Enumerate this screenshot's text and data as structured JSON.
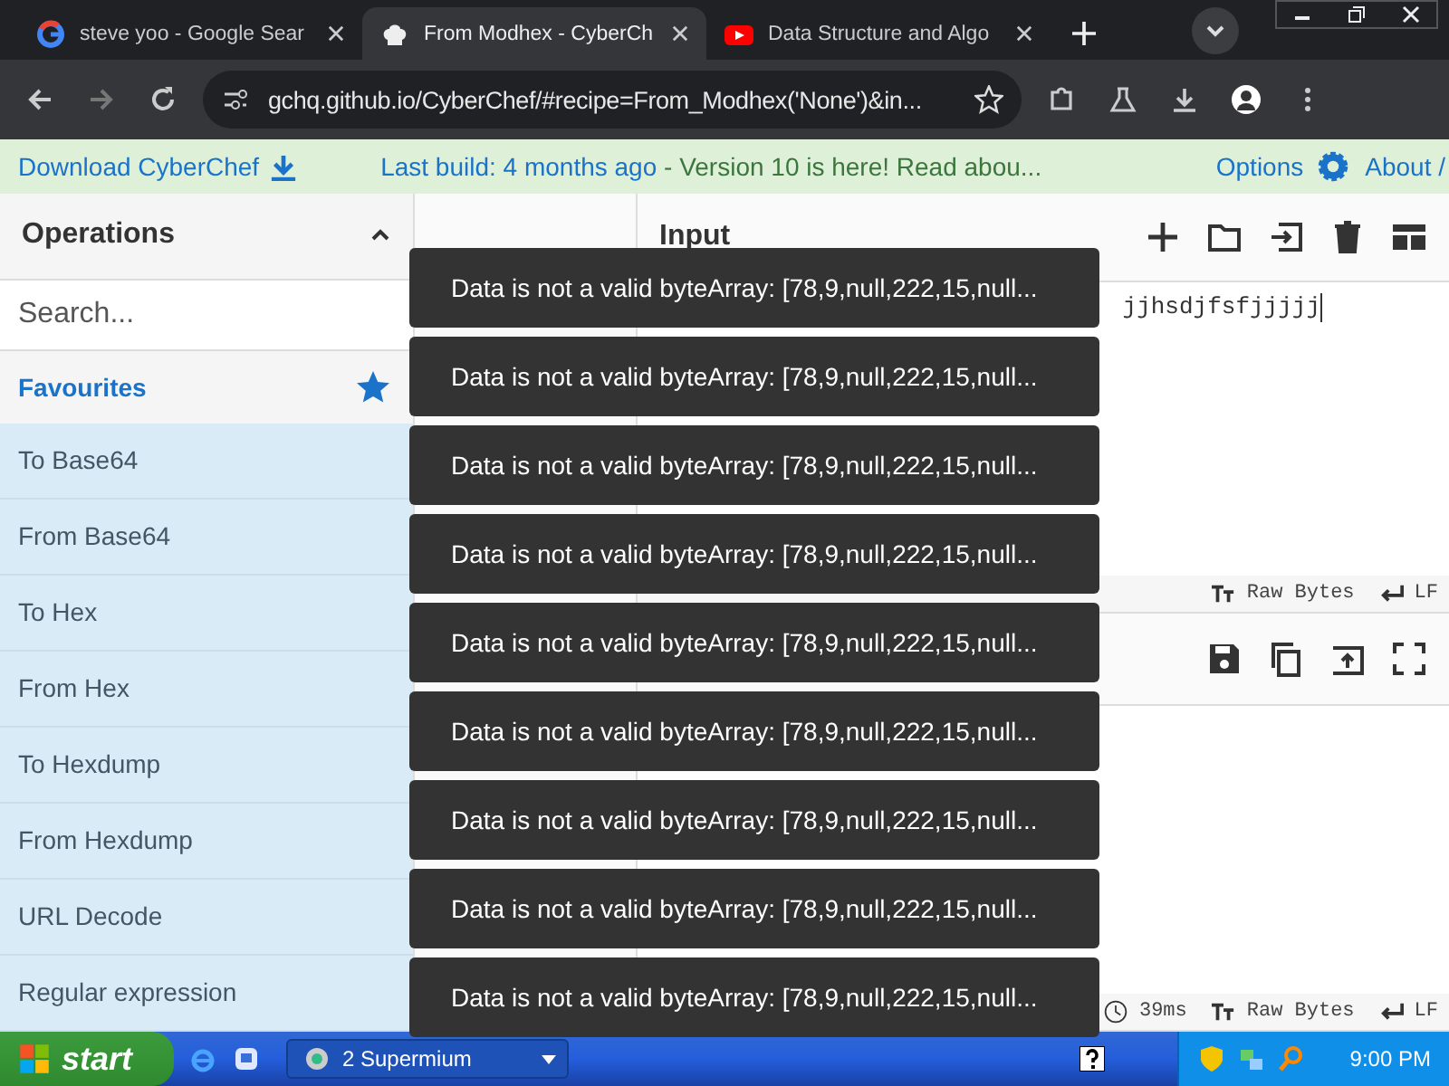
{
  "browser": {
    "tabs": [
      {
        "title": "steve yoo - Google Sear",
        "selected": false
      },
      {
        "title": "From Modhex - CyberCh",
        "selected": true
      },
      {
        "title": "Data Structure and Algo",
        "selected": false
      }
    ],
    "address": "gchq.github.io/CyberChef/#recipe=From_Modhex('None')&in..."
  },
  "banner": {
    "download": "Download CyberChef",
    "build": "Last build: 4 months ago",
    "notice": " - Version 10 is here! Read abou...",
    "options": "Options",
    "about": "About /"
  },
  "operations": {
    "title": "Operations",
    "search_placeholder": "Search...",
    "favourites": "Favourites",
    "items": [
      "To Base64",
      "From Base64",
      "To Hex",
      "From Hex",
      "To Hexdump",
      "From Hexdump",
      "URL Decode",
      "Regular expression"
    ]
  },
  "input": {
    "title": "Input",
    "text": "jjhsdjfsfjjjjj",
    "format": "Raw Bytes",
    "eol": "LF"
  },
  "output": {
    "time": "39ms",
    "format": "Raw Bytes",
    "eol": "LF"
  },
  "toasts": [
    "Data is not a valid byteArray: [78,9,null,222,15,null...",
    "Data is not a valid byteArray: [78,9,null,222,15,null...",
    "Data is not a valid byteArray: [78,9,null,222,15,null...",
    "Data is not a valid byteArray: [78,9,null,222,15,null...",
    "Data is not a valid byteArray: [78,9,null,222,15,null...",
    "Data is not a valid byteArray: [78,9,null,222,15,null...",
    "Data is not a valid byteArray: [78,9,null,222,15,null...",
    "Data is not a valid byteArray: [78,9,null,222,15,null...",
    "Data is not a valid byteArray: [78,9,null,222,15,null..."
  ],
  "taskbar": {
    "start": "start",
    "task": "2 Supermium",
    "clock": "9:00 PM"
  }
}
